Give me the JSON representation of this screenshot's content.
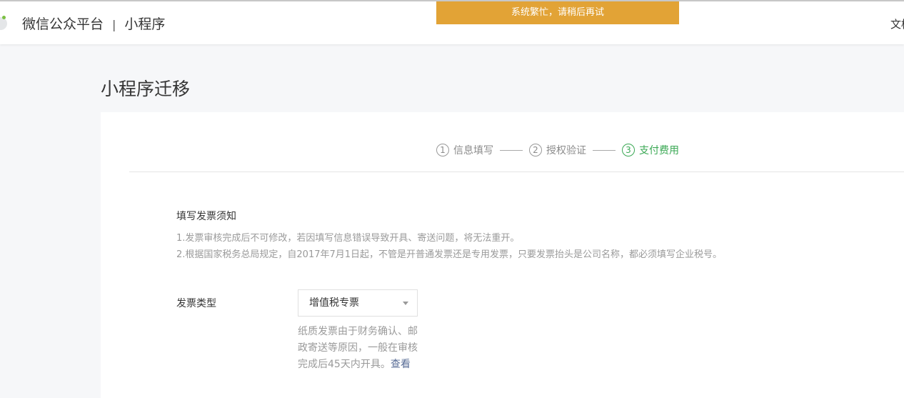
{
  "header": {
    "brand": "微信公众平台",
    "separator": "|",
    "product": "小程序",
    "doc_link": "文档"
  },
  "toast": "系统繁忙，请稍后再试",
  "page_title": "小程序迁移",
  "steps": [
    {
      "num": "1",
      "label": "信息填写"
    },
    {
      "num": "2",
      "label": "授权验证"
    },
    {
      "num": "3",
      "label": "支付费用"
    }
  ],
  "notice": {
    "title": "填写发票须知",
    "items": [
      "1.发票审核完成后不可修改，若因填写信息错误导致开具、寄送问题，将无法重开。",
      "2.根据国家税务总局规定，自2017年7月1日起，不管是开普通发票还是专用发票，只要发票抬头是公司名称，都必须填写企业税号。"
    ]
  },
  "invoice": {
    "label": "发票类型",
    "selected": "增值税专票",
    "tip": "纸质发票由于财务确认、邮政寄送等原因，一般在审核完成后45天内开具。",
    "tip_link": "查看"
  },
  "colors": {
    "toast": "#e2a336",
    "active_step": "#3aa854",
    "link": "#576b95"
  }
}
